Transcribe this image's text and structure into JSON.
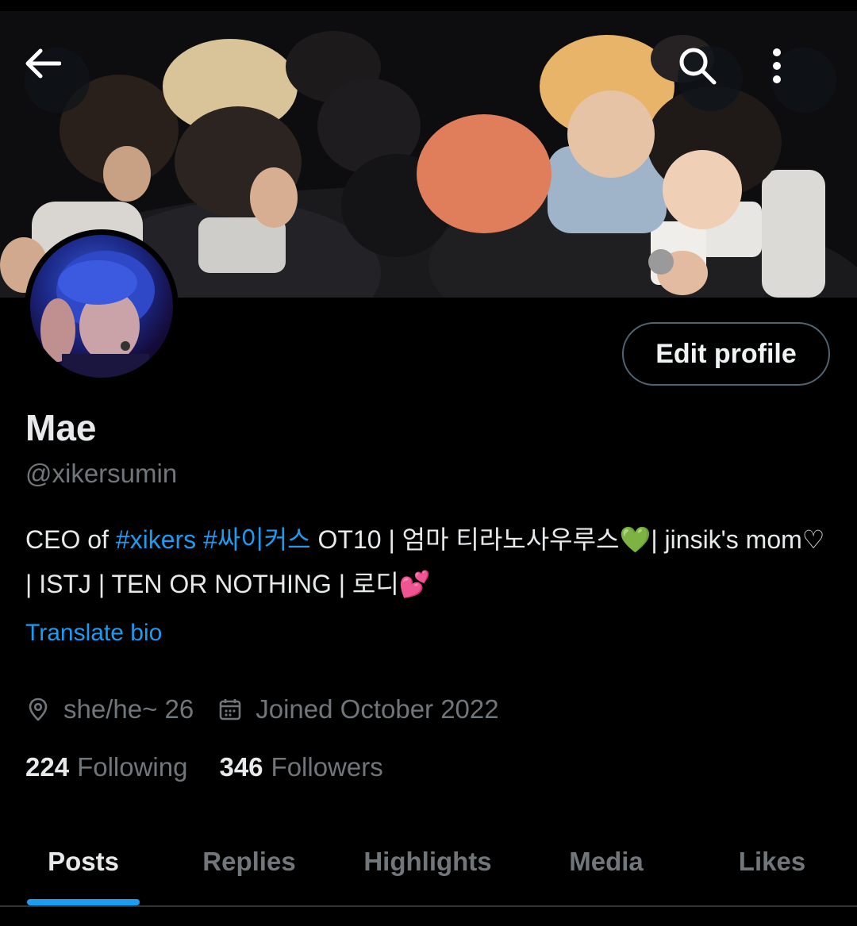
{
  "header": {
    "back_icon": "arrow-left-icon",
    "search_icon": "search-icon",
    "more_icon": "more-vertical-icon"
  },
  "profile": {
    "name": "Mae",
    "handle": "@xikersumin",
    "edit_label": "Edit profile",
    "bio": {
      "prefix": "CEO of ",
      "hashtag1": "#xikers",
      "space": " ",
      "hashtag2": "#싸이커스",
      "middle": " OT10 | 엄마 티라노사우루스",
      "green_heart": "💚",
      "after_heart": "| jinsik's mom♡ | ISTJ | TEN OR NOTHING | 로디",
      "pink_hearts": "💕"
    },
    "translate_label": "Translate bio",
    "location": "she/he~ 26",
    "joined": "Joined October 2022",
    "following_count": "224",
    "following_label": "Following",
    "followers_count": "346",
    "followers_label": "Followers"
  },
  "tabs": [
    {
      "label": "Posts",
      "active": true
    },
    {
      "label": "Replies",
      "active": false
    },
    {
      "label": "Highlights",
      "active": false
    },
    {
      "label": "Media",
      "active": false
    },
    {
      "label": "Likes",
      "active": false
    }
  ],
  "colors": {
    "accent": "#1d9bf0",
    "background": "#000000",
    "primary_text": "#e7e9ea",
    "secondary_text": "#71767b"
  }
}
